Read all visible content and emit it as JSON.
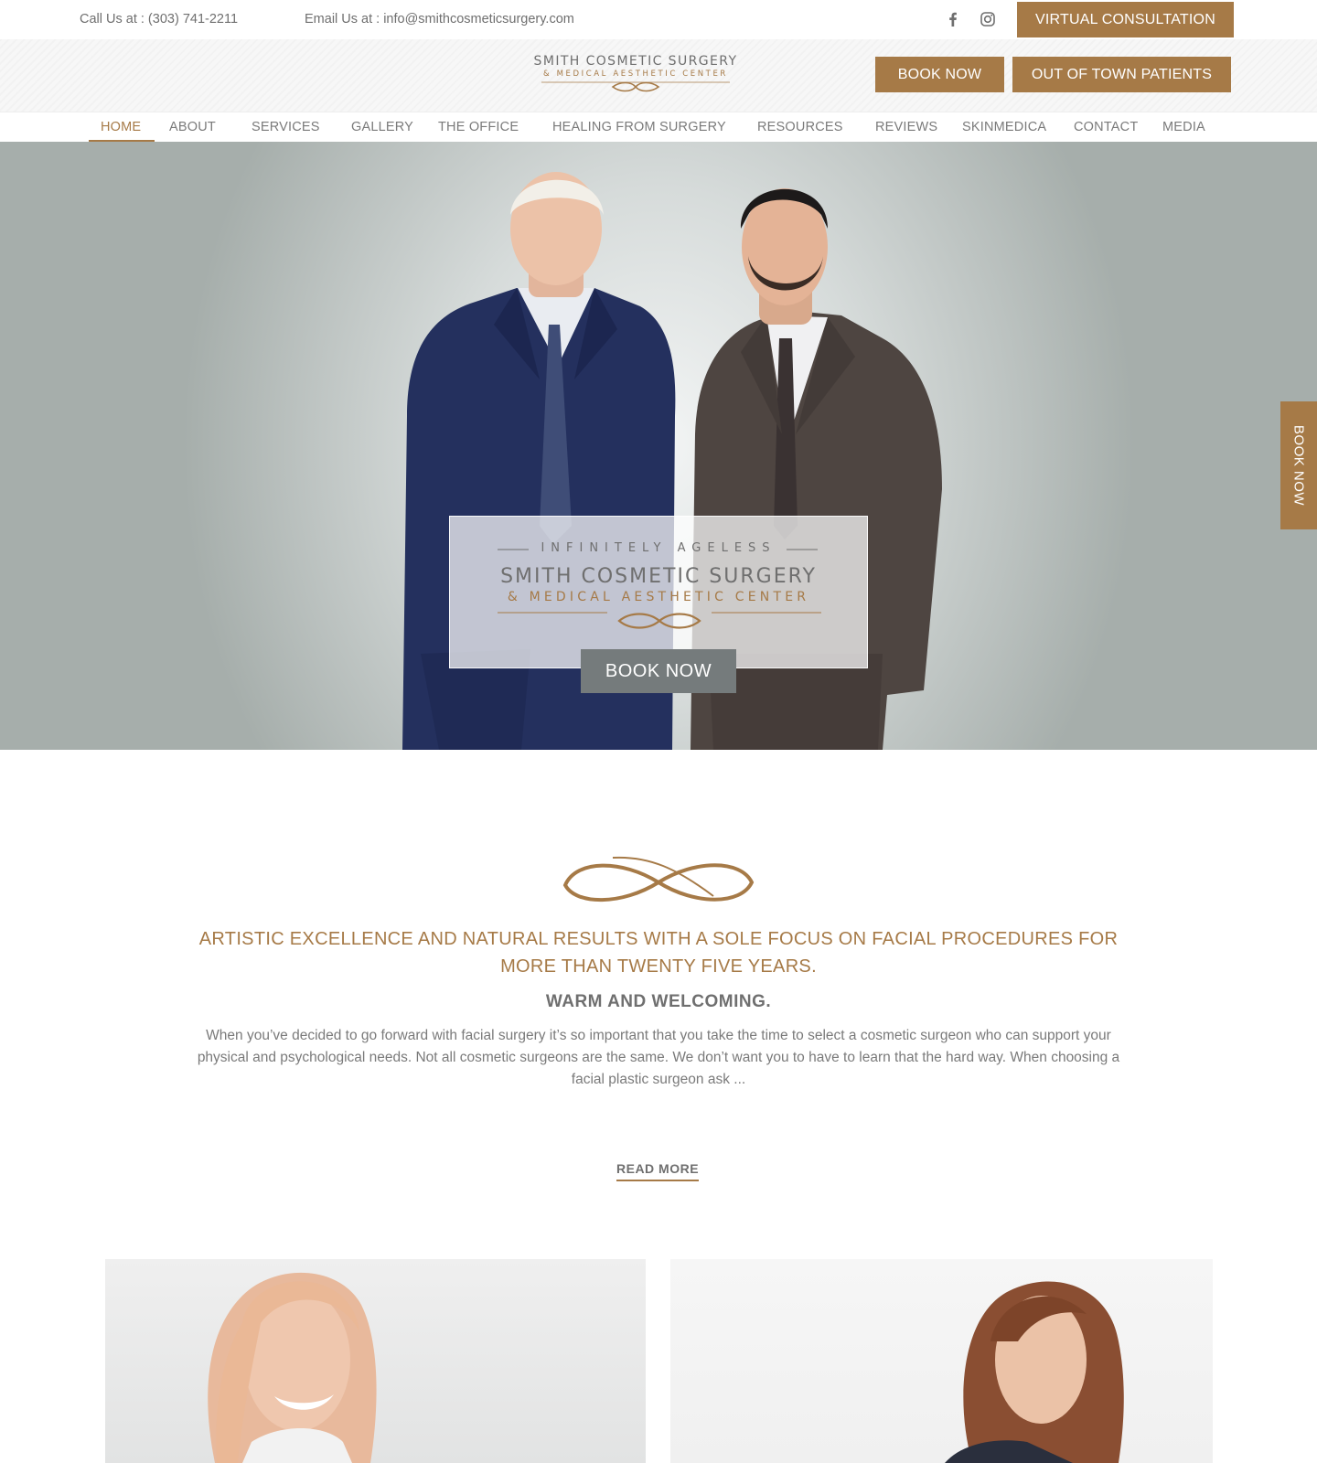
{
  "topbar": {
    "phone": "Call Us at : (303) 741-2211",
    "email": "Email Us at : info@smithcosmeticsurgery.com",
    "virtual_consultation": "VIRTUAL CONSULTATION",
    "social_icons": [
      "facebook-icon",
      "instagram-icon"
    ]
  },
  "header": {
    "logo_line1": "SMITH COSMETIC SURGERY",
    "logo_line2": "& MEDICAL AESTHETIC CENTER",
    "book_now": "BOOK NOW",
    "out_of_town": "OUT OF TOWN PATIENTS"
  },
  "nav": {
    "items": [
      "HOME",
      "ABOUT",
      "SERVICES",
      "GALLERY",
      "THE OFFICE",
      "HEALING FROM SURGERY",
      "RESOURCES",
      "REVIEWS",
      "SKINMEDICA",
      "CONTACT",
      "MEDIA"
    ],
    "active": "HOME"
  },
  "hero": {
    "tagline": "INFINITELY AGELESS",
    "name_line1": "SMITH COSMETIC SURGERY",
    "name_line2": "& MEDICAL AESTHETIC CENTER",
    "book_now": "BOOK NOW",
    "side_book_now": "BOOK NOW"
  },
  "intro": {
    "title": "ARTISTIC EXCELLENCE AND NATURAL RESULTS WITH A SOLE FOCUS ON FACIAL PROCEDURES FOR MORE THAN TWENTY FIVE YEARS.",
    "subtitle": "WARM AND WELCOMING.",
    "body": "When you’ve decided to go forward with facial surgery it’s so important that you take the time to select a cosmetic surgeon who can support your physical and psychological needs. Not all cosmetic surgeons are the same. We don’t want you to have to learn that the hard way. When choosing a facial plastic surgeon ask ...",
    "read_more": "READ MORE"
  },
  "colors": {
    "gold": "#a67a47",
    "gray_text": "#6f6f6f",
    "hero_button": "#757b7c"
  }
}
